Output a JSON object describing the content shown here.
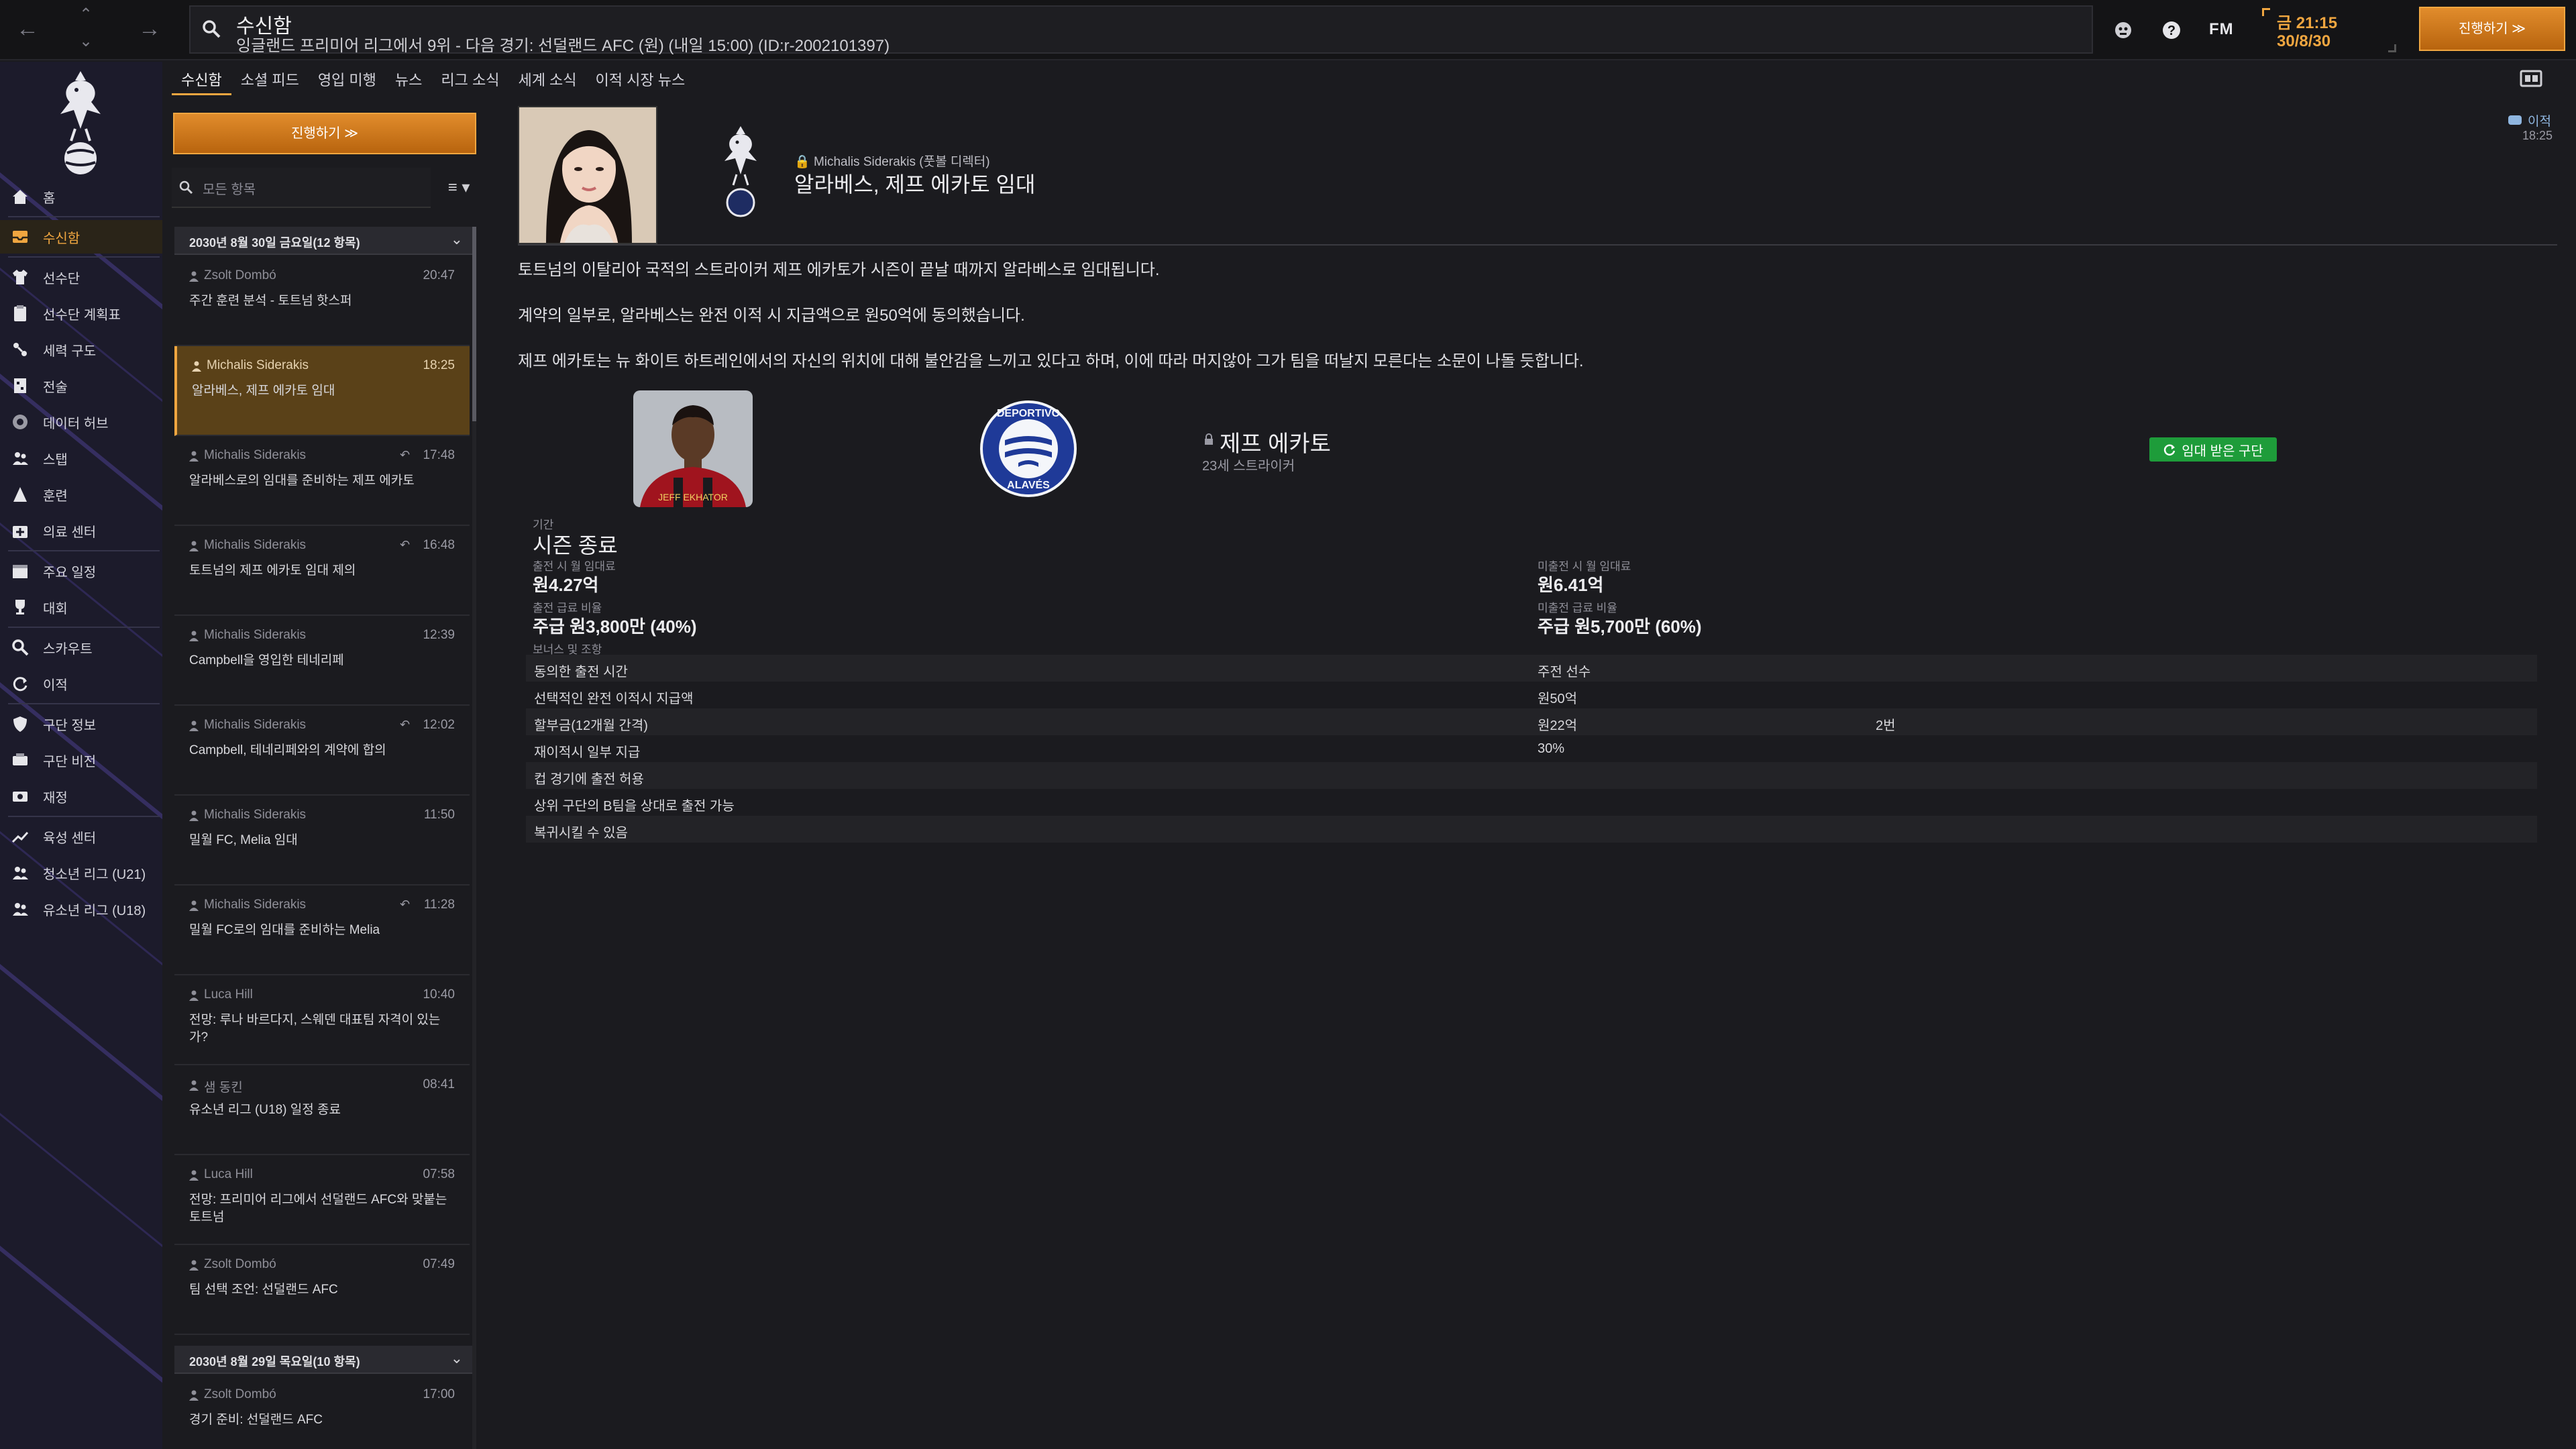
{
  "colors": {
    "accent": "#f0a640",
    "positive": "#1e9c3a",
    "tag": "#8fb6e0"
  },
  "topbar": {
    "title": "수신함",
    "subtitle": "잉글랜드 프리미어 리그에서 9위 - 다음 경기: 선덜랜드 AFC (원) (내일 15:00) (ID:r-2002101397)",
    "fm_logo": "FM",
    "clock_time": "금 21:15",
    "clock_date": "30/8/30",
    "continue_label": "진행하기 ≫",
    "icons": [
      "back-arrow-icon",
      "chevron-up-icon",
      "chevron-down-icon",
      "forward-arrow-icon",
      "search-icon",
      "bug-icon",
      "help-icon"
    ]
  },
  "sidebar": {
    "items": [
      {
        "label": "홈",
        "icon": "home-icon"
      },
      {
        "label": "수신함",
        "icon": "inbox-icon",
        "active": true
      },
      {
        "label": "선수단",
        "icon": "shirt-icon"
      },
      {
        "label": "선수단 계획표",
        "icon": "clipboard-icon"
      },
      {
        "label": "세력 구도",
        "icon": "dynamics-icon"
      },
      {
        "label": "전술",
        "icon": "tactics-icon"
      },
      {
        "label": "데이터 허브",
        "icon": "data-hub-icon"
      },
      {
        "label": "스탭",
        "icon": "staff-icon"
      },
      {
        "label": "훈련",
        "icon": "training-icon"
      },
      {
        "label": "의료 센터",
        "icon": "medical-icon"
      },
      {
        "label": "주요 일정",
        "icon": "calendar-icon"
      },
      {
        "label": "대회",
        "icon": "trophy-icon"
      },
      {
        "label": "스카우트",
        "icon": "scout-icon"
      },
      {
        "label": "이적",
        "icon": "transfer-icon"
      },
      {
        "label": "구단 정보",
        "icon": "shield-icon"
      },
      {
        "label": "구단 비전",
        "icon": "vision-icon"
      },
      {
        "label": "재정",
        "icon": "finance-icon"
      },
      {
        "label": "육성 센터",
        "icon": "development-icon"
      },
      {
        "label": "청소년 리그 (U21)",
        "icon": "youth-icon"
      },
      {
        "label": "유소년 리그 (U18)",
        "icon": "youth-icon"
      }
    ]
  },
  "tabs": [
    "수신함",
    "소셜 피드",
    "영입 미행",
    "뉴스",
    "리그 소식",
    "세계 소식",
    "이적 시장 뉴스"
  ],
  "inbox": {
    "continue_label": "진행하기 ≫",
    "search_placeholder": "모든 항목",
    "filter_label": "≡ ▾",
    "groups": [
      {
        "label": "2030년 8월 30일 금요일(12 항목)"
      },
      {
        "label": "2030년 8월 29일 목요일(10 항목)"
      }
    ],
    "messages": [
      {
        "sender": "Zsolt Dombó",
        "time": "20:47",
        "subject": "주간 훈련 분석 - 토트넘 핫스퍼",
        "reply": false
      },
      {
        "sender": "Michalis Siderakis",
        "time": "18:25",
        "subject": "알라베스, 제프 에카토 임대",
        "reply": false,
        "active": true
      },
      {
        "sender": "Michalis Siderakis",
        "time": "17:48",
        "subject": "알라베스로의 임대를 준비하는 제프 에카토",
        "reply": true
      },
      {
        "sender": "Michalis Siderakis",
        "time": "16:48",
        "subject": "토트넘의 제프 에카토 임대 제의",
        "reply": true
      },
      {
        "sender": "Michalis Siderakis",
        "time": "12:39",
        "subject": "Campbell을 영입한 테네리페",
        "reply": false
      },
      {
        "sender": "Michalis Siderakis",
        "time": "12:02",
        "subject": "Campbell, 테네리페와의 계약에 합의",
        "reply": true
      },
      {
        "sender": "Michalis Siderakis",
        "time": "11:50",
        "subject": "밀월 FC, Melia 임대",
        "reply": false
      },
      {
        "sender": "Michalis Siderakis",
        "time": "11:28",
        "subject": "밀월 FC로의 임대를 준비하는 Melia",
        "reply": true
      },
      {
        "sender": "Luca Hill",
        "time": "10:40",
        "subject": "전망: 루나 바르다지, 스웨덴 대표팀 자격이 있는가?",
        "reply": false
      },
      {
        "sender": "샘 동킨",
        "time": "08:41",
        "subject": "유소년 리그 (U18) 일정 종료",
        "reply": false
      },
      {
        "sender": "Luca Hill",
        "time": "07:58",
        "subject": "전망: 프리미어 리그에서 선덜랜드 AFC와 맞붙는 토트넘",
        "reply": false
      },
      {
        "sender": "Zsolt Dombó",
        "time": "07:49",
        "subject": "팀 선택 조언: 선덜랜드 AFC",
        "reply": false
      },
      {
        "sender": "Zsolt Dombó",
        "time": "17:00",
        "subject": "경기 준비: 선덜랜드 AFC",
        "reply": false
      }
    ]
  },
  "message": {
    "from": "Michalis Siderakis (풋볼 디렉터)",
    "title": "알라베스, 제프 에카토 임대",
    "tag_label": "이적",
    "tag_time": "18:25",
    "paragraphs": [
      "토트넘의 이탈리아 국적의 스트라이커 제프 에카토가 시즌이 끝날 때까지 알라베스로 임대됩니다.",
      "계약의 일부로, 알라베스는 완전 이적 시 지급액으로 원50억에 동의했습니다.",
      "제프 에카토는 뉴 화이트 하트레인에서의 자신의 위치에 대해 불안감을 느끼고 있다고 하며, 이에 따라 머지않아 그가 팀을 떠날지 모른다는 소문이 나돌 듯합니다."
    ],
    "player": {
      "name": "제프 에카토",
      "info": "23세 스트라이커"
    },
    "loan_club_label": "임대 받은 구단",
    "duration_label": "기간",
    "duration_value": "시즌 종료",
    "appear_wage_label": "출전 시 월 임대료",
    "appear_wage_value": "원4.27억",
    "noappear_wage_label": "미출전 시 월 임대료",
    "noappear_wage_value": "원6.41억",
    "appear_ratio_label": "출전 급료 비율",
    "appear_ratio_value": "주급 원3,800만 (40%)",
    "noappear_ratio_label": "미출전 급료 비율",
    "noappear_ratio_value": "주급 원5,700만 (60%)",
    "bonus_label": "보너스 및 조항",
    "clauses": [
      {
        "name": "동의한 출전 시간",
        "value": "주전 선수",
        "extra": ""
      },
      {
        "name": "선택적인 완전 이적시 지급액",
        "value": "원50억",
        "extra": ""
      },
      {
        "name": "할부금(12개월 간격)",
        "value": "원22억",
        "extra": "2번"
      },
      {
        "name": "재이적시 일부 지급",
        "value": "30%",
        "extra": ""
      },
      {
        "name": "컵 경기에 출전 허용",
        "value": "",
        "extra": ""
      },
      {
        "name": "상위 구단의 B팀을 상대로 출전 가능",
        "value": "",
        "extra": ""
      },
      {
        "name": "복귀시킬 수 있음",
        "value": "",
        "extra": ""
      }
    ]
  }
}
